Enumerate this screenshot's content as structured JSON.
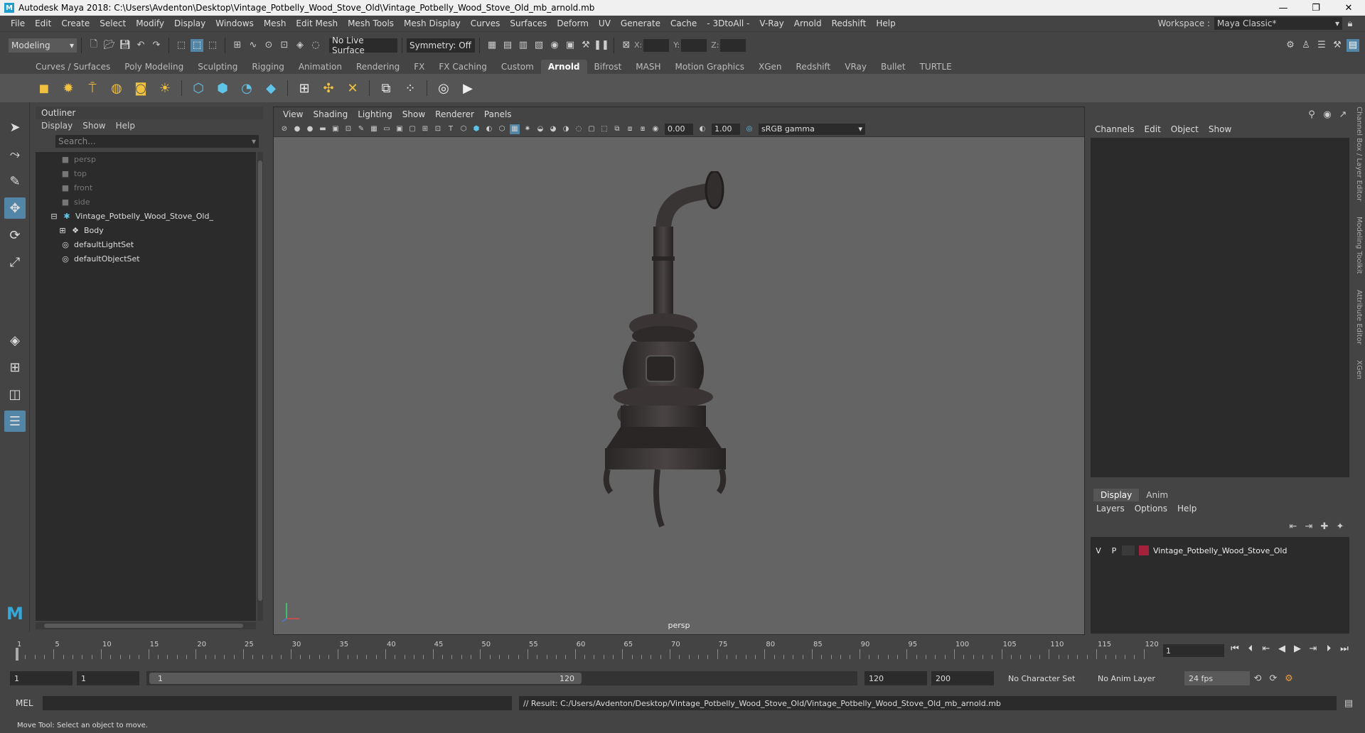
{
  "window": {
    "title": "Autodesk Maya 2018: C:\\Users\\Avdenton\\Desktop\\Vintage_Potbelly_Wood_Stove_Old\\Vintage_Potbelly_Wood_Stove_Old_mb_arnold.mb",
    "logo": "M",
    "minimize": "—",
    "maximize": "❐",
    "close": "✕"
  },
  "menubar": {
    "items": [
      "File",
      "Edit",
      "Create",
      "Select",
      "Modify",
      "Display",
      "Windows",
      "Mesh",
      "Edit Mesh",
      "Mesh Tools",
      "Mesh Display",
      "Curves",
      "Surfaces",
      "Deform",
      "UV",
      "Generate",
      "Cache",
      "- 3DtoAll -",
      "V-Ray",
      "Arnold",
      "Redshift",
      "Help"
    ],
    "workspace_label": "Workspace :",
    "workspace_value": "Maya Classic*"
  },
  "statusline": {
    "mode": "Modeling",
    "live_surface": "No Live Surface",
    "symmetry": "Symmetry: Off",
    "x_label": "X:",
    "y_label": "Y:",
    "z_label": "Z:"
  },
  "shelf": {
    "tabs": [
      "Curves / Surfaces",
      "Poly Modeling",
      "Sculpting",
      "Rigging",
      "Animation",
      "Rendering",
      "FX",
      "FX Caching",
      "Custom",
      "Arnold",
      "Bifrost",
      "MASH",
      "Motion Graphics",
      "XGen",
      "Redshift",
      "VRay",
      "Bullet",
      "TURTLE"
    ],
    "active_tab": "Arnold"
  },
  "outliner": {
    "title": "Outliner",
    "menu": [
      "Display",
      "Show",
      "Help"
    ],
    "search_placeholder": "Search...",
    "items": [
      {
        "label": "persp",
        "icon": "camera-icon",
        "dim": true
      },
      {
        "label": "top",
        "icon": "camera-icon",
        "dim": true
      },
      {
        "label": "front",
        "icon": "camera-icon",
        "dim": true
      },
      {
        "label": "side",
        "icon": "camera-icon",
        "dim": true
      },
      {
        "label": "Vintage_Potbelly_Wood_Stove_Old_",
        "icon": "group-icon",
        "dim": false
      },
      {
        "label": "Body",
        "icon": "mesh-icon",
        "dim": false
      },
      {
        "label": "defaultLightSet",
        "icon": "set-icon",
        "dim": false
      },
      {
        "label": "defaultObjectSet",
        "icon": "set-icon",
        "dim": false
      }
    ]
  },
  "viewport": {
    "menu": [
      "View",
      "Shading",
      "Lighting",
      "Show",
      "Renderer",
      "Panels"
    ],
    "exposure": "0.00",
    "gamma": "1.00",
    "color_space": "sRGB gamma",
    "camera_label": "persp"
  },
  "channelbox": {
    "menu": [
      "Channels",
      "Edit",
      "Object",
      "Show"
    ],
    "side_tabs": [
      "Channel Box / Layer Editor",
      "Modeling Toolkit",
      "Attribute Editor",
      "XGen"
    ]
  },
  "layers": {
    "tabs": [
      "Display",
      "Anim"
    ],
    "active_tab": "Display",
    "menu": [
      "Layers",
      "Options",
      "Help"
    ],
    "rows": [
      {
        "v": "V",
        "p": "P",
        "name": "Vintage_Potbelly_Wood_Stove_Old",
        "color": "#a3213a"
      }
    ]
  },
  "timeline": {
    "tick_labels": [
      "1",
      "5",
      "10",
      "15",
      "20",
      "25",
      "30",
      "35",
      "40",
      "45",
      "50",
      "55",
      "60",
      "65",
      "70",
      "75",
      "80",
      "85",
      "90",
      "95",
      "100",
      "105",
      "110",
      "115",
      "120"
    ],
    "current_frame": "1"
  },
  "range": {
    "start": "1",
    "playback_start": "1",
    "range_start": "1",
    "range_end": "120",
    "playback_end": "120",
    "end": "200",
    "character_set": "No Character Set",
    "anim_layer": "No Anim Layer",
    "fps": "24 fps"
  },
  "command": {
    "lang": "MEL",
    "result": "// Result: C:/Users/Avdenton/Desktop/Vintage_Potbelly_Wood_Stove_Old/Vintage_Potbelly_Wood_Stove_Old_mb_arnold.mb"
  },
  "help_line": "Move Tool: Select an object to move."
}
